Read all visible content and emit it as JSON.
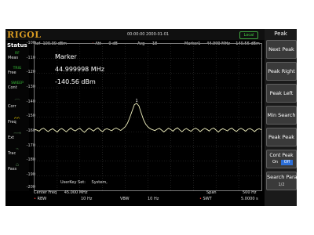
{
  "header": {
    "brand": "RIGOL",
    "datetime": "00:00:00  2000-01-01",
    "local_label": "Local"
  },
  "settings": {
    "ref_label": "Ref",
    "ref_value": "-100.00 dBm",
    "att_label": "Att",
    "att_value": "0 dB",
    "avg_label": "Avg",
    "avg_value": "18",
    "marker_label": "Marker1",
    "marker_freq": "44.999 MHz",
    "marker_amp": "-140.56 dBm"
  },
  "status": {
    "title": "Status",
    "items": [
      {
        "top": "RF",
        "bottom": "Meas",
        "color": "green"
      },
      {
        "top": "TRIG",
        "bottom": "Free",
        "color": "green"
      },
      {
        "top": "SWEEP",
        "bottom": "Cont",
        "color": "green"
      },
      {
        "top": "Corr",
        "bottom": "",
        "color": "dim"
      },
      {
        "top": "Freq",
        "bottom": "",
        "color": "yellow"
      },
      {
        "top": "Ext",
        "bottom": "",
        "color": "dim"
      },
      {
        "top": "Trac",
        "bottom": "",
        "color": "dim"
      },
      {
        "top": "Pass",
        "bottom": "",
        "color": "dim"
      }
    ]
  },
  "y_axis": {
    "ticks": [
      "-100",
      "-110",
      "-120",
      "-130",
      "-140",
      "-150",
      "-160",
      "-170",
      "-180",
      "-190",
      "-200"
    ]
  },
  "marker_display": {
    "title": "Marker",
    "freq": "44.999998 MHz",
    "amp": "-140.56 dBm",
    "number": "1"
  },
  "userkey": {
    "label": "UserKey Set:",
    "value": "System,"
  },
  "footer": {
    "center_label": "Center Freq",
    "center_value": "45.000 MHz",
    "span_label": "Span",
    "span_value": "500 Hz",
    "rbw_label": "RBW",
    "rbw_value": "10 Hz",
    "vbw_label": "VBW",
    "vbw_value": "10 Hz",
    "swt_label": "SWT",
    "swt_value": "5.0000 s"
  },
  "softkeys": {
    "title": "Peak",
    "next_peak": "Next Peak",
    "peak_right": "Peak Right",
    "peak_left": "Peak Left",
    "min_search": "Min Search",
    "peak_peak": "Peak Peak",
    "cont_peak": "Cont Peak",
    "cont_on": "On",
    "cont_off": "Off",
    "search_para": "Search Para",
    "page": "1/2"
  },
  "colors": {
    "trace": "#f2f2c0",
    "brand": "#d79a22",
    "active": "#2d6fd8"
  },
  "trace_data": {
    "ref_dbm": -100,
    "db_per_div": 10,
    "points_dbm": [
      -158.4,
      -158.9,
      -159.6,
      -158.2,
      -157.6,
      -158.8,
      -159.9,
      -158.7,
      -157.9,
      -159.1,
      -160.2,
      -158.5,
      -157.8,
      -158.9,
      -160.0,
      -158.6,
      -157.5,
      -158.7,
      -159.4,
      -158.3,
      -157.7,
      -159.2,
      -160.4,
      -158.8,
      -157.6,
      -158.5,
      -159.5,
      -158.2,
      -157.4,
      -158.9,
      -159.9,
      -158.4,
      -157.9,
      -158.6,
      -159.3,
      -158.1,
      -157.5,
      -158.3,
      -159.1,
      -157.9,
      -156.5,
      -154.0,
      -150.2,
      -145.8,
      -141.5,
      -140.6,
      -142.3,
      -147.0,
      -151.6,
      -154.8,
      -156.7,
      -157.9,
      -158.6,
      -159.2,
      -158.3,
      -157.7,
      -158.8,
      -160.1,
      -158.9,
      -157.6,
      -158.4,
      -159.6,
      -158.2,
      -157.3,
      -158.7,
      -160.0,
      -158.5,
      -157.8,
      -158.9,
      -159.7,
      -158.3,
      -157.6,
      -158.5,
      -159.9,
      -158.6,
      -157.7,
      -158.4,
      -159.5,
      -158.1,
      -157.5,
      -158.8,
      -160.2,
      -158.7,
      -157.9,
      -158.6,
      -159.4,
      -158.2,
      -157.6,
      -158.9,
      -159.8,
      -158.4,
      -157.7,
      -158.5,
      -159.6,
      -158.3,
      -157.8,
      -158.7,
      -159.9,
      -158.5,
      -157.9,
      -158.6
    ]
  }
}
